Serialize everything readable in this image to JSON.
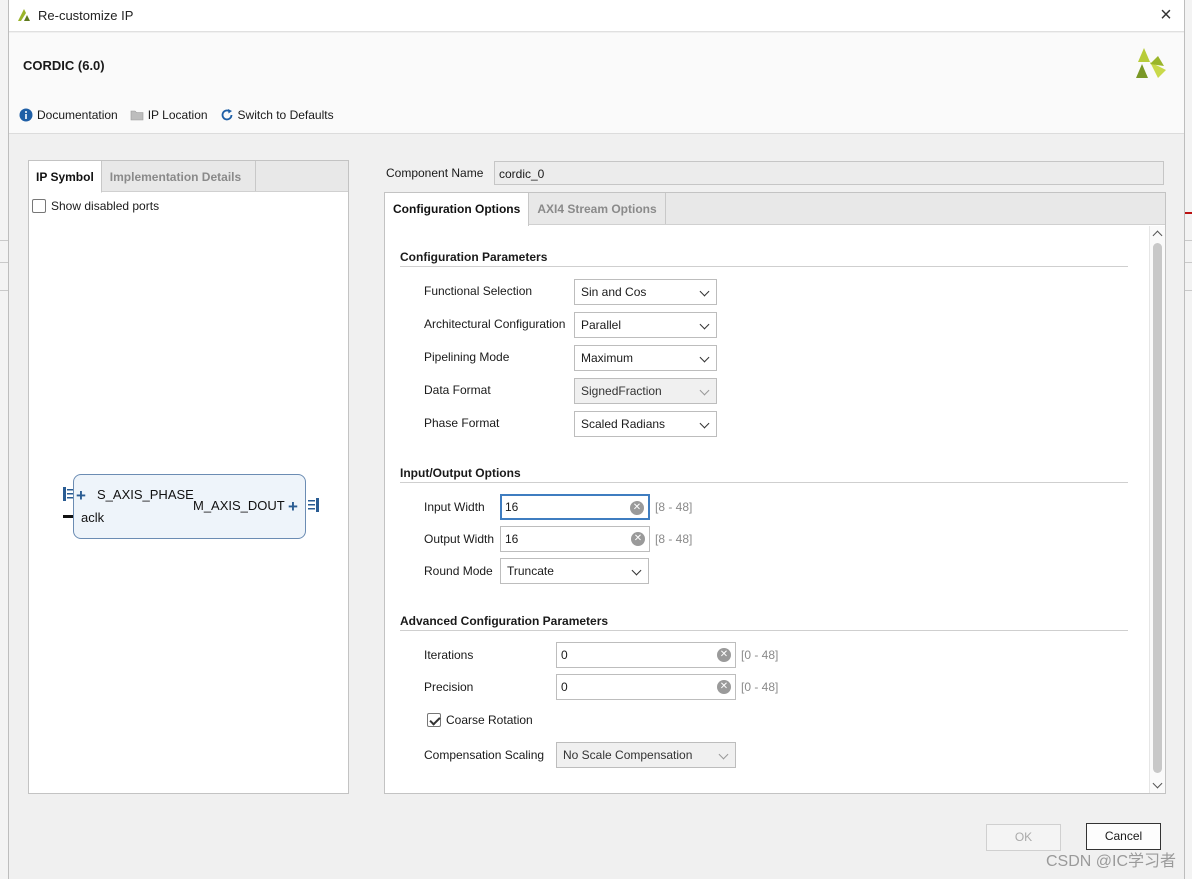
{
  "window": {
    "title": "Re-customize IP"
  },
  "header": {
    "ip_name": "CORDIC (6.0)",
    "toolbar": {
      "documentation": "Documentation",
      "ip_location": "IP Location",
      "switch_defaults": "Switch to Defaults"
    }
  },
  "left_panel": {
    "tabs": [
      "IP Symbol",
      "Implementation Details"
    ],
    "active_tab": "IP Symbol",
    "show_disabled_ports": {
      "label": "Show disabled ports",
      "checked": false
    },
    "symbol": {
      "input_port": "S_AXIS_PHASE",
      "output_port": "M_AXIS_DOUT",
      "clock_port": "aclk"
    }
  },
  "component_name": {
    "label": "Component Name",
    "value": "cordic_0"
  },
  "right_panel": {
    "tabs": [
      "Configuration Options",
      "AXI4 Stream Options"
    ],
    "active_tab": "Configuration Options",
    "config_params": {
      "title": "Configuration Parameters",
      "functional_selection": {
        "label": "Functional Selection",
        "value": "Sin and Cos"
      },
      "architectural_config": {
        "label": "Architectural Configuration",
        "value": "Parallel"
      },
      "pipelining_mode": {
        "label": "Pipelining Mode",
        "value": "Maximum"
      },
      "data_format": {
        "label": "Data Format",
        "value": "SignedFraction"
      },
      "phase_format": {
        "label": "Phase Format",
        "value": "Scaled Radians"
      }
    },
    "io_options": {
      "title": "Input/Output Options",
      "input_width": {
        "label": "Input Width",
        "value": "16",
        "range": "[8 - 48]"
      },
      "output_width": {
        "label": "Output Width",
        "value": "16",
        "range": "[8 - 48]"
      },
      "round_mode": {
        "label": "Round Mode",
        "value": "Truncate"
      }
    },
    "advanced": {
      "title": "Advanced Configuration Parameters",
      "iterations": {
        "label": "Iterations",
        "value": "0",
        "range": "[0 - 48]"
      },
      "precision": {
        "label": "Precision",
        "value": "0",
        "range": "[0 - 48]"
      },
      "coarse_rotation": {
        "label": "Coarse Rotation",
        "checked": true
      },
      "compensation_scaling": {
        "label": "Compensation Scaling",
        "value": "No Scale Compensation"
      }
    }
  },
  "footer": {
    "ok": "OK",
    "cancel": "Cancel"
  },
  "watermark": "CSDN @IC学习者",
  "colors": {
    "accent_blue": "#3f7dc0",
    "logo_green": "#9ab52a",
    "logo_dark": "#5f7a1f"
  }
}
